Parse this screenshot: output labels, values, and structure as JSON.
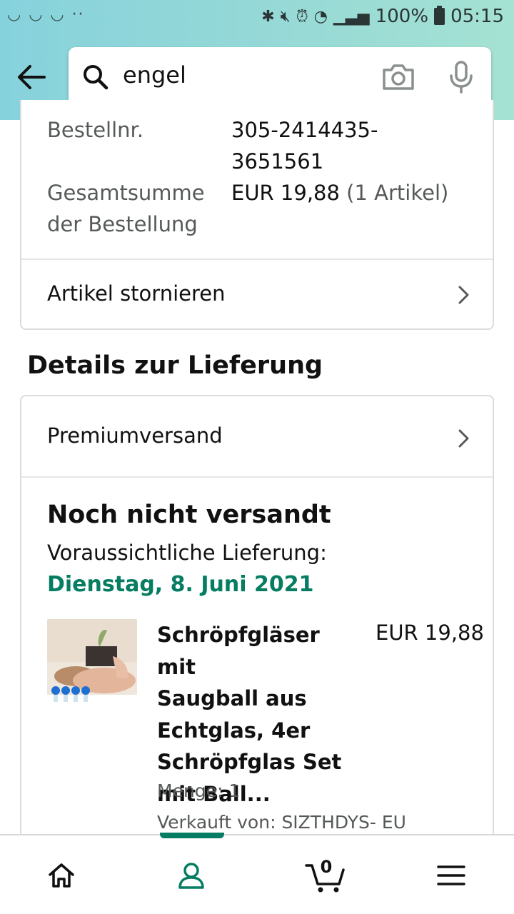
{
  "status_bar": {
    "left_icons": "◡ ◡ ◡  ··",
    "battery": "100%",
    "time": "05:15"
  },
  "header": {
    "search_value": "engel",
    "back_icon": "arrow-left-icon",
    "search_icon": "search-icon",
    "camera_icon": "camera-icon",
    "mic_icon": "mic-icon"
  },
  "order": {
    "order_number_label": "Bestellnr.",
    "order_number_line1": "305-2414435-",
    "order_number_line2": "3651561",
    "total_label_line1": "Gesamtsumme",
    "total_label_line2": "der Bestellung",
    "total_value": "EUR 19,88",
    "total_items": "(1 Artikel)",
    "cancel_label": "Artikel stornieren"
  },
  "delivery": {
    "section_title": "Details zur Lieferung",
    "shipping_method": "Premiumversand",
    "status": "Noch nicht versandt",
    "expected_label": "Voraussichtliche Lieferung:",
    "expected_date": "Dienstag, 8. Juni 2021",
    "date_color": "#067d62"
  },
  "product": {
    "title_lines": [
      "Schröpfgläser mit",
      "Saugball aus",
      "Echtglas, 4er",
      "Schröpfglas Set",
      "mit Ball..."
    ],
    "price": "EUR 19,88",
    "quantity": "Menge: 1",
    "seller": "Verkauft von: SIZTHDYS- EU"
  },
  "bottom_nav": {
    "items": [
      "home-icon",
      "account-icon",
      "cart-icon",
      "menu-icon"
    ],
    "active": "account-icon",
    "cart_count": "0",
    "accent": "#067d62"
  }
}
